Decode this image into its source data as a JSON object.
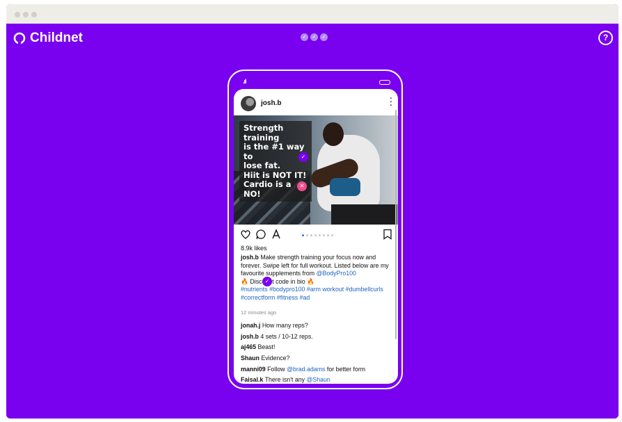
{
  "app": {
    "brand_name": "Childnet",
    "progress_steps": [
      "✓",
      "✓",
      "✓"
    ],
    "help_label": "?"
  },
  "colors": {
    "brand_purple": "#7a00f0",
    "link_blue": "#1f64c0",
    "error_pink": "#ee4d8f"
  },
  "phone": {
    "signal_label": ".ıl",
    "post": {
      "username": "josh.b",
      "image_overlay": [
        "Strength training",
        "is the #1 way to",
        "lose fat.",
        "Hiit is NOT IT!",
        "Cardio is a NO!"
      ],
      "likes": "8.9k likes",
      "caption": {
        "user": "josh.b",
        "text": "Make strength training your focus now and forever. Swipe left for full workout. Listed below are my favourite supplements from",
        "mention": "@BodyPro100",
        "discount_line": "🔥 Discount code in bio 🔥",
        "hashtags": "#nutrients #bodypro100 #arm workout #dumbellcurls #correctform #fitness #ad"
      },
      "timestamp": "12 minutes ago",
      "comments": [
        {
          "user": "jonah.j",
          "text": "How many reps?",
          "mention": "",
          "suffix": ""
        },
        {
          "user": "josh.b",
          "text": "4 sets / 10-12 reps.",
          "mention": "",
          "suffix": ""
        },
        {
          "user": "aj465",
          "text": "Beast!",
          "mention": "",
          "suffix": ""
        },
        {
          "user": "Shaun",
          "text": "Evidence?",
          "mention": "",
          "suffix": ""
        },
        {
          "user": "manni09",
          "text": "Follow",
          "mention": "@brad.adams",
          "suffix": "for better form"
        },
        {
          "user": "Faisal.k",
          "text": "There isn't any",
          "mention": "@Shaun",
          "suffix": ""
        }
      ]
    }
  },
  "icons": {
    "brand": "childnet-logo-icon",
    "help": "help-icon",
    "like": "heart-icon",
    "comment": "comment-icon",
    "share": "share-icon",
    "save": "bookmark-icon",
    "more": "more-options-icon"
  }
}
